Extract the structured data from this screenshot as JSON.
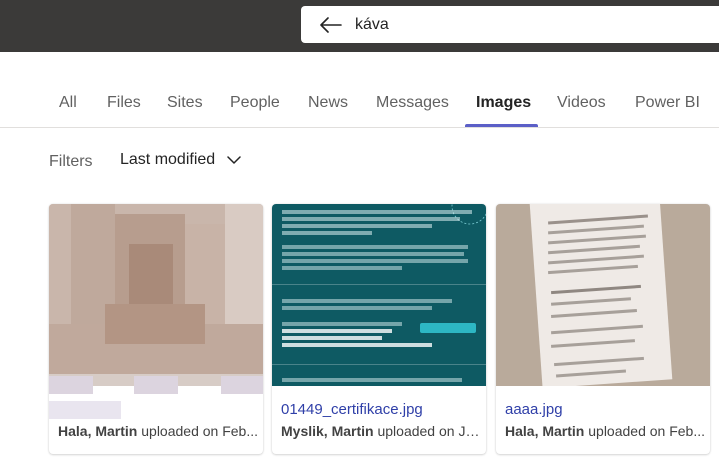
{
  "search": {
    "query": "káva"
  },
  "tabs": [
    {
      "label": "All"
    },
    {
      "label": "Files"
    },
    {
      "label": "Sites"
    },
    {
      "label": "People"
    },
    {
      "label": "News"
    },
    {
      "label": "Messages"
    },
    {
      "label": "Images",
      "active": true
    },
    {
      "label": "Videos"
    },
    {
      "label": "Power BI"
    }
  ],
  "filters": {
    "label": "Filters",
    "sort": "Last modified"
  },
  "results": [
    {
      "title": "",
      "uploader": "Hala, Martin",
      "meta_suffix": " uploaded on Feb..."
    },
    {
      "title": "01449_certifikace.jpg",
      "uploader": "Myslik, Martin",
      "meta_suffix": " uploaded on Ju..."
    },
    {
      "title": "aaaa.jpg",
      "uploader": "Hala, Martin",
      "meta_suffix": " uploaded on Feb..."
    }
  ],
  "colors": {
    "accent": "#5b5fc7",
    "link": "#2f3fa8",
    "topbar": "#3b3a39"
  }
}
